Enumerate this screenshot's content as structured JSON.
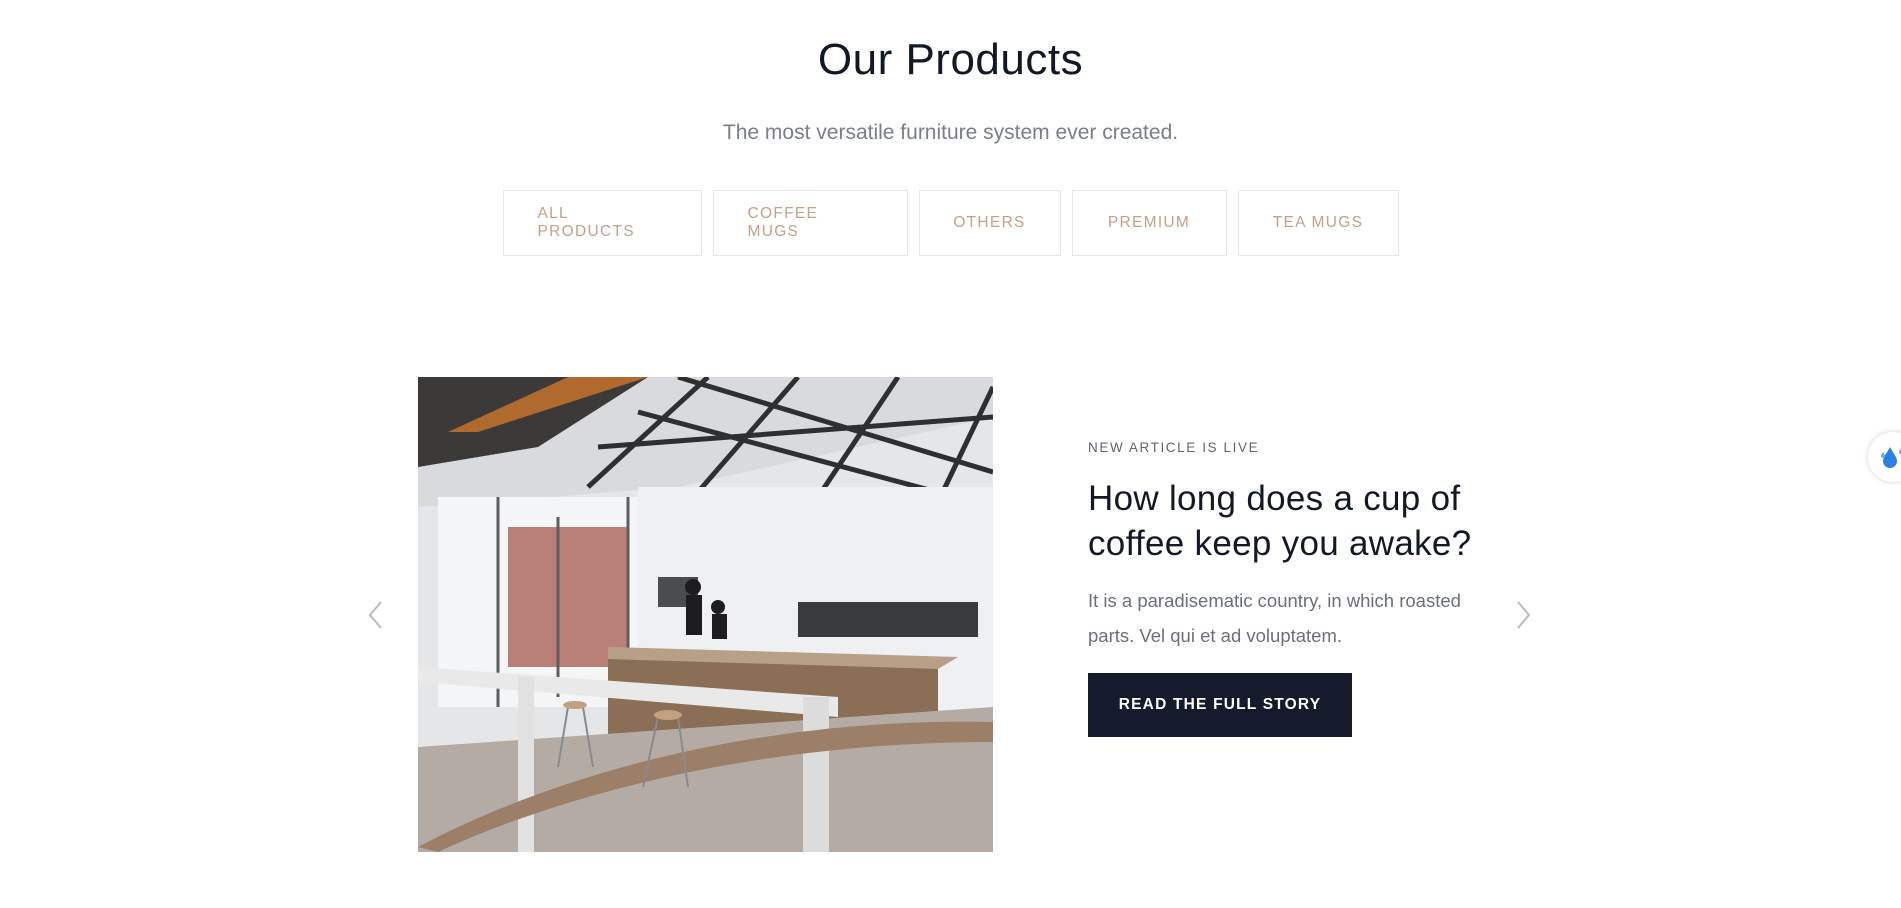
{
  "header": {
    "title": "Our Products",
    "subtitle": "The most versatile furniture system ever created."
  },
  "filters": [
    {
      "label": "ALL PRODUCTS"
    },
    {
      "label": "COFFEE MUGS"
    },
    {
      "label": "OTHERS"
    },
    {
      "label": "PREMIUM"
    },
    {
      "label": "TEA MUGS"
    }
  ],
  "slider": {
    "prev_icon": "chevron-left-icon",
    "next_icon": "chevron-right-icon",
    "image_icon": "coffee-shop-interior-photo",
    "article": {
      "kicker": "NEW ARTICLE IS LIVE",
      "headline": "How long does a cup of coffee keep you awake?",
      "excerpt": "It is a paradisematic country, in which roasted parts. Vel qui et ad voluptatem.",
      "cta_label": "READ THE FULL STORY"
    }
  },
  "side_widget": {
    "icon": "water-drops-icon"
  },
  "colors": {
    "accent": "#c4a08b",
    "cta_background": "#151b2c",
    "title": "#121826",
    "muted_text": "#7a7f86"
  }
}
